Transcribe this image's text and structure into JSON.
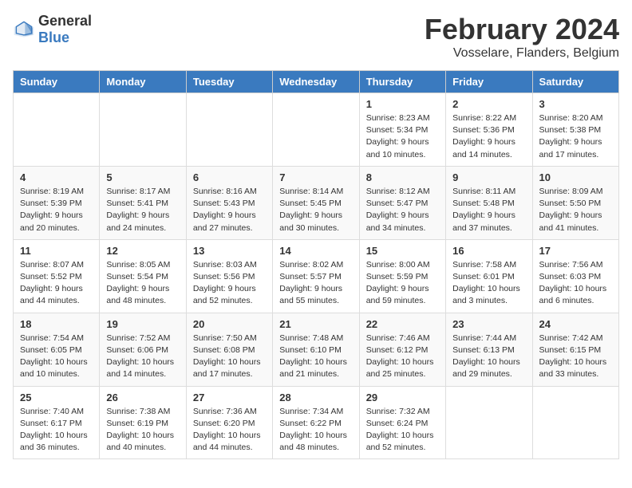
{
  "logo": {
    "general": "General",
    "blue": "Blue"
  },
  "title": "February 2024",
  "subtitle": "Vosselare, Flanders, Belgium",
  "headers": [
    "Sunday",
    "Monday",
    "Tuesday",
    "Wednesday",
    "Thursday",
    "Friday",
    "Saturday"
  ],
  "weeks": [
    [
      {
        "day": "",
        "info": ""
      },
      {
        "day": "",
        "info": ""
      },
      {
        "day": "",
        "info": ""
      },
      {
        "day": "",
        "info": ""
      },
      {
        "day": "1",
        "info": "Sunrise: 8:23 AM\nSunset: 5:34 PM\nDaylight: 9 hours\nand 10 minutes."
      },
      {
        "day": "2",
        "info": "Sunrise: 8:22 AM\nSunset: 5:36 PM\nDaylight: 9 hours\nand 14 minutes."
      },
      {
        "day": "3",
        "info": "Sunrise: 8:20 AM\nSunset: 5:38 PM\nDaylight: 9 hours\nand 17 minutes."
      }
    ],
    [
      {
        "day": "4",
        "info": "Sunrise: 8:19 AM\nSunset: 5:39 PM\nDaylight: 9 hours\nand 20 minutes."
      },
      {
        "day": "5",
        "info": "Sunrise: 8:17 AM\nSunset: 5:41 PM\nDaylight: 9 hours\nand 24 minutes."
      },
      {
        "day": "6",
        "info": "Sunrise: 8:16 AM\nSunset: 5:43 PM\nDaylight: 9 hours\nand 27 minutes."
      },
      {
        "day": "7",
        "info": "Sunrise: 8:14 AM\nSunset: 5:45 PM\nDaylight: 9 hours\nand 30 minutes."
      },
      {
        "day": "8",
        "info": "Sunrise: 8:12 AM\nSunset: 5:47 PM\nDaylight: 9 hours\nand 34 minutes."
      },
      {
        "day": "9",
        "info": "Sunrise: 8:11 AM\nSunset: 5:48 PM\nDaylight: 9 hours\nand 37 minutes."
      },
      {
        "day": "10",
        "info": "Sunrise: 8:09 AM\nSunset: 5:50 PM\nDaylight: 9 hours\nand 41 minutes."
      }
    ],
    [
      {
        "day": "11",
        "info": "Sunrise: 8:07 AM\nSunset: 5:52 PM\nDaylight: 9 hours\nand 44 minutes."
      },
      {
        "day": "12",
        "info": "Sunrise: 8:05 AM\nSunset: 5:54 PM\nDaylight: 9 hours\nand 48 minutes."
      },
      {
        "day": "13",
        "info": "Sunrise: 8:03 AM\nSunset: 5:56 PM\nDaylight: 9 hours\nand 52 minutes."
      },
      {
        "day": "14",
        "info": "Sunrise: 8:02 AM\nSunset: 5:57 PM\nDaylight: 9 hours\nand 55 minutes."
      },
      {
        "day": "15",
        "info": "Sunrise: 8:00 AM\nSunset: 5:59 PM\nDaylight: 9 hours\nand 59 minutes."
      },
      {
        "day": "16",
        "info": "Sunrise: 7:58 AM\nSunset: 6:01 PM\nDaylight: 10 hours\nand 3 minutes."
      },
      {
        "day": "17",
        "info": "Sunrise: 7:56 AM\nSunset: 6:03 PM\nDaylight: 10 hours\nand 6 minutes."
      }
    ],
    [
      {
        "day": "18",
        "info": "Sunrise: 7:54 AM\nSunset: 6:05 PM\nDaylight: 10 hours\nand 10 minutes."
      },
      {
        "day": "19",
        "info": "Sunrise: 7:52 AM\nSunset: 6:06 PM\nDaylight: 10 hours\nand 14 minutes."
      },
      {
        "day": "20",
        "info": "Sunrise: 7:50 AM\nSunset: 6:08 PM\nDaylight: 10 hours\nand 17 minutes."
      },
      {
        "day": "21",
        "info": "Sunrise: 7:48 AM\nSunset: 6:10 PM\nDaylight: 10 hours\nand 21 minutes."
      },
      {
        "day": "22",
        "info": "Sunrise: 7:46 AM\nSunset: 6:12 PM\nDaylight: 10 hours\nand 25 minutes."
      },
      {
        "day": "23",
        "info": "Sunrise: 7:44 AM\nSunset: 6:13 PM\nDaylight: 10 hours\nand 29 minutes."
      },
      {
        "day": "24",
        "info": "Sunrise: 7:42 AM\nSunset: 6:15 PM\nDaylight: 10 hours\nand 33 minutes."
      }
    ],
    [
      {
        "day": "25",
        "info": "Sunrise: 7:40 AM\nSunset: 6:17 PM\nDaylight: 10 hours\nand 36 minutes."
      },
      {
        "day": "26",
        "info": "Sunrise: 7:38 AM\nSunset: 6:19 PM\nDaylight: 10 hours\nand 40 minutes."
      },
      {
        "day": "27",
        "info": "Sunrise: 7:36 AM\nSunset: 6:20 PM\nDaylight: 10 hours\nand 44 minutes."
      },
      {
        "day": "28",
        "info": "Sunrise: 7:34 AM\nSunset: 6:22 PM\nDaylight: 10 hours\nand 48 minutes."
      },
      {
        "day": "29",
        "info": "Sunrise: 7:32 AM\nSunset: 6:24 PM\nDaylight: 10 hours\nand 52 minutes."
      },
      {
        "day": "",
        "info": ""
      },
      {
        "day": "",
        "info": ""
      }
    ]
  ]
}
